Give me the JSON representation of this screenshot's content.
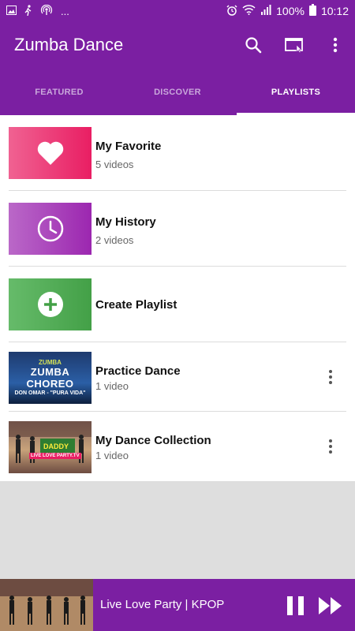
{
  "status_bar": {
    "left_icons": [
      "image-icon",
      "walking-icon",
      "podcast-icon"
    ],
    "ellipsis": "...",
    "battery": "100%",
    "time": "10:12"
  },
  "app": {
    "title": "Zumba Dance",
    "actions": [
      "search-icon",
      "cast-icon",
      "more-vert-icon"
    ]
  },
  "tabs": [
    {
      "label": "FEATURED",
      "active": false
    },
    {
      "label": "DISCOVER",
      "active": false
    },
    {
      "label": "PLAYLISTS",
      "active": true
    }
  ],
  "playlists": [
    {
      "title": "My Favorite",
      "subtitle": "5 videos",
      "icon": "heart-icon",
      "color": "#ec407a"
    },
    {
      "title": "My History",
      "subtitle": "2 videos",
      "icon": "clock-icon",
      "color": "#ab47bc"
    },
    {
      "title": "Create Playlist",
      "subtitle": "",
      "icon": "add-circle-icon",
      "color": "#4caf50"
    },
    {
      "title": "Practice Dance",
      "subtitle": "1 video",
      "thumb_top": "ZUMBA",
      "thumb_main": "ZUMBA CHOREO",
      "thumb_sub": "DON OMAR - \"PURA VIDA\""
    },
    {
      "title": "My Dance Collection",
      "subtitle": "1 video",
      "thumb_top": "DADDY",
      "thumb_sub": "LIVE LOVE PARTY.TV"
    }
  ],
  "player": {
    "title": "Live Love Party | KPOP",
    "accent": "#7b1fa2"
  }
}
